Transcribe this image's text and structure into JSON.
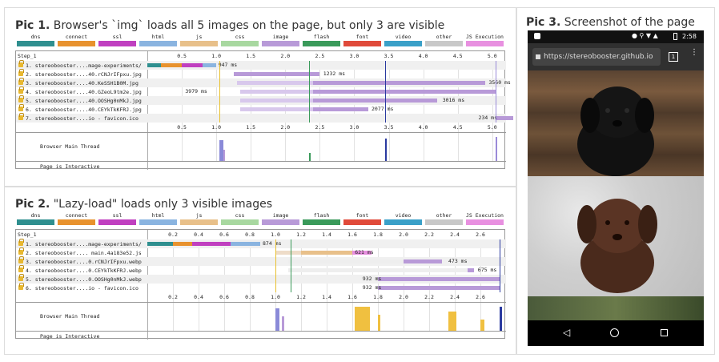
{
  "pic1": {
    "title_bold": "Pic 1.",
    "title_rest": " Browser's `img` loads all 5 images on the page, but only 3 are visible",
    "step": "Step_1",
    "ticks": [
      "0.5",
      "1.0",
      "1.5",
      "2.0",
      "2.5",
      "3.0",
      "3.5",
      "4.0",
      "4.5",
      "5.0"
    ],
    "rows": [
      {
        "label": "1. stereobooster....mage-experiments/",
        "time": "947 ms"
      },
      {
        "label": "2. stereobooster....40.rCNJrIFpxu.jpg",
        "time": "1232 ms"
      },
      {
        "label": "3. stereobooster....40.KeSSH1B0M.jpg",
        "time": "3560 ms"
      },
      {
        "label": "4. stereobooster....40.GZeoL9tm2e.jpg",
        "time": "3979 ms"
      },
      {
        "label": "5. stereobooster....40.OOSHg0nMkJ.jpg",
        "time": "3016 ms"
      },
      {
        "label": "6. stereobooster....40.CEYkTkKFRJ.jpg",
        "time": "2077 ms"
      },
      {
        "label": "7. stereobooster....io - favicon.ico",
        "time": "234 ms"
      }
    ],
    "thread_label": "Browser Main Thread",
    "interactive_label": "Page is Interactive"
  },
  "pic2": {
    "title_bold": "Pic 2.",
    "title_rest": " \"Lazy-load\" loads only 3 visible images",
    "step": "Step_1",
    "ticks": [
      "0.2",
      "0.4",
      "0.6",
      "0.8",
      "1.0",
      "1.2",
      "1.4",
      "1.6",
      "1.8",
      "2.0",
      "2.2",
      "2.4",
      "2.6"
    ],
    "rows": [
      {
        "label": "1. stereobooster....mage-experiments/",
        "time": "874 ms"
      },
      {
        "label": "2. stereobooster.... main.4a183e52.js",
        "time": "621 ms"
      },
      {
        "label": "3. stereobooster....0.rCNJrIFpxu.webp",
        "time": "473 ms"
      },
      {
        "label": "4. stereobooster....0.CEYkTkKFRJ.webp",
        "time": "675 ms"
      },
      {
        "label": "5. stereobooster....0.OOSHg0nMkJ.webp",
        "time": "932 ms"
      },
      {
        "label": "6. stereobooster....io - favicon.ico",
        "time": "932 ms"
      }
    ],
    "thread_label": "Browser Main Thread",
    "interactive_label": "Page is Interactive"
  },
  "legend": [
    {
      "label": "dns",
      "color": "#2f8f8f"
    },
    {
      "label": "connect",
      "color": "#e8922e"
    },
    {
      "label": "ssl",
      "color": "#c040c0"
    },
    {
      "label": "html",
      "color": "#8ab4e0"
    },
    {
      "label": "js",
      "color": "#e8c08a"
    },
    {
      "label": "css",
      "color": "#a8d8a0"
    },
    {
      "label": "image",
      "color": "#b89ad8"
    },
    {
      "label": "flash",
      "color": "#3a9a5a"
    },
    {
      "label": "font",
      "color": "#e04a3a"
    },
    {
      "label": "video",
      "color": "#3aa0c8"
    },
    {
      "label": "other",
      "color": "#c8c8c8"
    },
    {
      "label": "JS Execution",
      "color": "#e890e0"
    }
  ],
  "pic3": {
    "title_bold": "Pic 3.",
    "title_rest": " Screenshot of the page",
    "clock": "2:58",
    "url": "https://stereobooster.github.io",
    "tab_count": "1"
  }
}
